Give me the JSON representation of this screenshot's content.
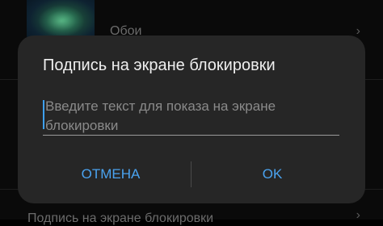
{
  "background": {
    "wallpaper_item_label": "Обои",
    "bottom_item_label": "Подпись на экране блокировки",
    "chevron": "›"
  },
  "dialog": {
    "title": "Подпись на экране блокировки",
    "input_placeholder": "Введите текст для показа на экране блокировки",
    "input_value": "",
    "cancel_label": "ОТМЕНА",
    "ok_label": "OK"
  },
  "colors": {
    "dialog_background": "#262626",
    "accent": "#4aa3f0",
    "title_text": "#efefef",
    "placeholder_text": "#8a8a8a"
  },
  "icons": [
    "wallpaper-thumbnail",
    "chevron-right-icon"
  ]
}
